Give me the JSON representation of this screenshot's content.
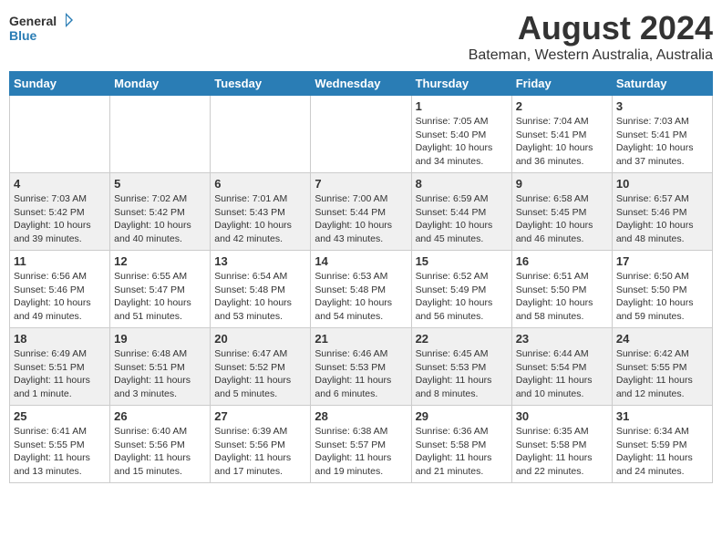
{
  "header": {
    "logo_line1": "General",
    "logo_line2": "Blue",
    "month_title": "August 2024",
    "location": "Bateman, Western Australia, Australia"
  },
  "days_of_week": [
    "Sunday",
    "Monday",
    "Tuesday",
    "Wednesday",
    "Thursday",
    "Friday",
    "Saturday"
  ],
  "weeks": [
    [
      {
        "day": "",
        "info": ""
      },
      {
        "day": "",
        "info": ""
      },
      {
        "day": "",
        "info": ""
      },
      {
        "day": "",
        "info": ""
      },
      {
        "day": "1",
        "info": "Sunrise: 7:05 AM\nSunset: 5:40 PM\nDaylight: 10 hours\nand 34 minutes."
      },
      {
        "day": "2",
        "info": "Sunrise: 7:04 AM\nSunset: 5:41 PM\nDaylight: 10 hours\nand 36 minutes."
      },
      {
        "day": "3",
        "info": "Sunrise: 7:03 AM\nSunset: 5:41 PM\nDaylight: 10 hours\nand 37 minutes."
      }
    ],
    [
      {
        "day": "4",
        "info": "Sunrise: 7:03 AM\nSunset: 5:42 PM\nDaylight: 10 hours\nand 39 minutes."
      },
      {
        "day": "5",
        "info": "Sunrise: 7:02 AM\nSunset: 5:42 PM\nDaylight: 10 hours\nand 40 minutes."
      },
      {
        "day": "6",
        "info": "Sunrise: 7:01 AM\nSunset: 5:43 PM\nDaylight: 10 hours\nand 42 minutes."
      },
      {
        "day": "7",
        "info": "Sunrise: 7:00 AM\nSunset: 5:44 PM\nDaylight: 10 hours\nand 43 minutes."
      },
      {
        "day": "8",
        "info": "Sunrise: 6:59 AM\nSunset: 5:44 PM\nDaylight: 10 hours\nand 45 minutes."
      },
      {
        "day": "9",
        "info": "Sunrise: 6:58 AM\nSunset: 5:45 PM\nDaylight: 10 hours\nand 46 minutes."
      },
      {
        "day": "10",
        "info": "Sunrise: 6:57 AM\nSunset: 5:46 PM\nDaylight: 10 hours\nand 48 minutes."
      }
    ],
    [
      {
        "day": "11",
        "info": "Sunrise: 6:56 AM\nSunset: 5:46 PM\nDaylight: 10 hours\nand 49 minutes."
      },
      {
        "day": "12",
        "info": "Sunrise: 6:55 AM\nSunset: 5:47 PM\nDaylight: 10 hours\nand 51 minutes."
      },
      {
        "day": "13",
        "info": "Sunrise: 6:54 AM\nSunset: 5:48 PM\nDaylight: 10 hours\nand 53 minutes."
      },
      {
        "day": "14",
        "info": "Sunrise: 6:53 AM\nSunset: 5:48 PM\nDaylight: 10 hours\nand 54 minutes."
      },
      {
        "day": "15",
        "info": "Sunrise: 6:52 AM\nSunset: 5:49 PM\nDaylight: 10 hours\nand 56 minutes."
      },
      {
        "day": "16",
        "info": "Sunrise: 6:51 AM\nSunset: 5:50 PM\nDaylight: 10 hours\nand 58 minutes."
      },
      {
        "day": "17",
        "info": "Sunrise: 6:50 AM\nSunset: 5:50 PM\nDaylight: 10 hours\nand 59 minutes."
      }
    ],
    [
      {
        "day": "18",
        "info": "Sunrise: 6:49 AM\nSunset: 5:51 PM\nDaylight: 11 hours\nand 1 minute."
      },
      {
        "day": "19",
        "info": "Sunrise: 6:48 AM\nSunset: 5:51 PM\nDaylight: 11 hours\nand 3 minutes."
      },
      {
        "day": "20",
        "info": "Sunrise: 6:47 AM\nSunset: 5:52 PM\nDaylight: 11 hours\nand 5 minutes."
      },
      {
        "day": "21",
        "info": "Sunrise: 6:46 AM\nSunset: 5:53 PM\nDaylight: 11 hours\nand 6 minutes."
      },
      {
        "day": "22",
        "info": "Sunrise: 6:45 AM\nSunset: 5:53 PM\nDaylight: 11 hours\nand 8 minutes."
      },
      {
        "day": "23",
        "info": "Sunrise: 6:44 AM\nSunset: 5:54 PM\nDaylight: 11 hours\nand 10 minutes."
      },
      {
        "day": "24",
        "info": "Sunrise: 6:42 AM\nSunset: 5:55 PM\nDaylight: 11 hours\nand 12 minutes."
      }
    ],
    [
      {
        "day": "25",
        "info": "Sunrise: 6:41 AM\nSunset: 5:55 PM\nDaylight: 11 hours\nand 13 minutes."
      },
      {
        "day": "26",
        "info": "Sunrise: 6:40 AM\nSunset: 5:56 PM\nDaylight: 11 hours\nand 15 minutes."
      },
      {
        "day": "27",
        "info": "Sunrise: 6:39 AM\nSunset: 5:56 PM\nDaylight: 11 hours\nand 17 minutes."
      },
      {
        "day": "28",
        "info": "Sunrise: 6:38 AM\nSunset: 5:57 PM\nDaylight: 11 hours\nand 19 minutes."
      },
      {
        "day": "29",
        "info": "Sunrise: 6:36 AM\nSunset: 5:58 PM\nDaylight: 11 hours\nand 21 minutes."
      },
      {
        "day": "30",
        "info": "Sunrise: 6:35 AM\nSunset: 5:58 PM\nDaylight: 11 hours\nand 22 minutes."
      },
      {
        "day": "31",
        "info": "Sunrise: 6:34 AM\nSunset: 5:59 PM\nDaylight: 11 hours\nand 24 minutes."
      }
    ]
  ]
}
